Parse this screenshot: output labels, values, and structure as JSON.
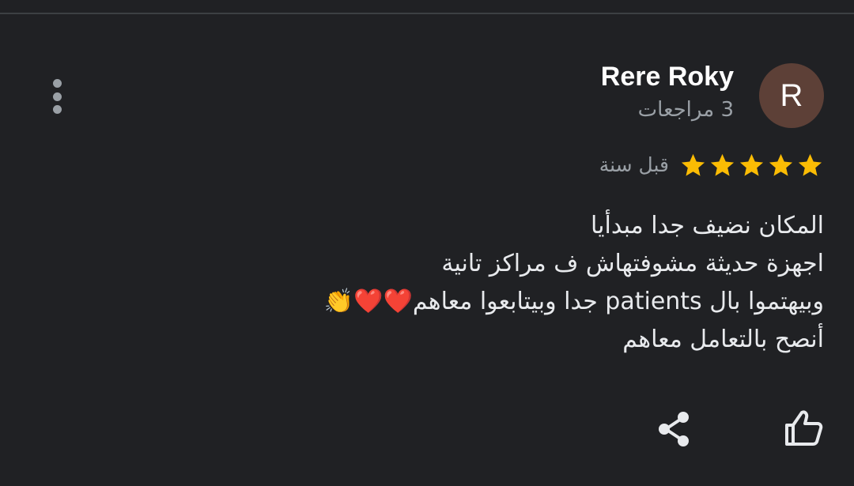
{
  "reviewer": {
    "avatar_initial": "R",
    "avatar_color": "#5d4037",
    "name": "Rere Roky",
    "review_count": "3 مراجعات"
  },
  "review": {
    "rating": 5,
    "max_rating": 5,
    "star_color": "#fbbc04",
    "date": "قبل سنة",
    "lines": [
      "المكان نضيف جدا مبدأيا",
      "اجهزة حديثة مشوفتهاش ف مراكز تانية",
      "وبيهتموا بال patients جدا وبيتابعوا معاهم❤️❤️👏",
      "أنصح بالتعامل معاهم"
    ]
  },
  "actions": {
    "more_icon": "more-vert-icon",
    "share_icon": "share-icon",
    "like_icon": "thumb-up-icon"
  }
}
